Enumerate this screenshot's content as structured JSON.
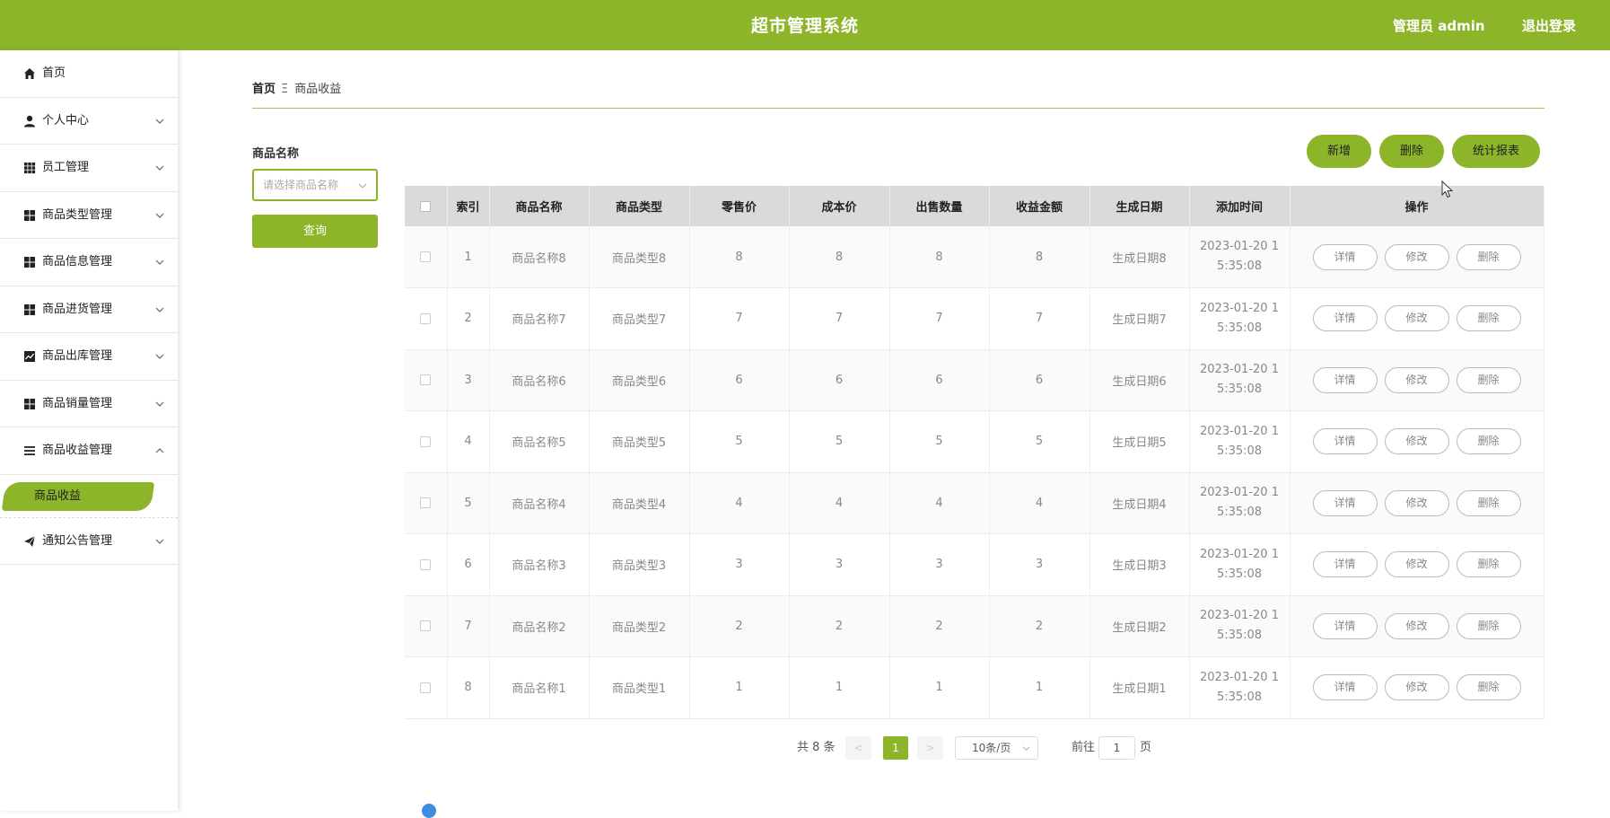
{
  "header": {
    "title": "超市管理系统",
    "user_label": "管理员 admin",
    "logout_label": "退出登录",
    "bg_color": "#8db52a"
  },
  "sidebar": {
    "items": [
      {
        "label": "首页",
        "icon": "home-icon"
      },
      {
        "label": "个人中心",
        "icon": "user-icon"
      },
      {
        "label": "员工管理",
        "icon": "grid-icon"
      },
      {
        "label": "商品类型管理",
        "icon": "apps-icon"
      },
      {
        "label": "商品信息管理",
        "icon": "apps-icon"
      },
      {
        "label": "商品进货管理",
        "icon": "apps-icon"
      },
      {
        "label": "商品出库管理",
        "icon": "chart-icon"
      },
      {
        "label": "商品销量管理",
        "icon": "apps-icon"
      },
      {
        "label": "商品收益管理",
        "icon": "list-icon"
      },
      {
        "label": "通知公告管理",
        "icon": "send-icon"
      }
    ],
    "active_sub": "商品收益"
  },
  "breadcrumb": {
    "home": "首页",
    "separator": "Ξ",
    "current": "商品收益"
  },
  "search": {
    "label": "商品名称",
    "placeholder": "请选择商品名称",
    "query_label": "查询"
  },
  "actions": {
    "add": "新增",
    "delete": "删除",
    "report": "统计报表"
  },
  "table": {
    "headers": [
      "索引",
      "商品名称",
      "商品类型",
      "零售价",
      "成本价",
      "出售数量",
      "收益金额",
      "生成日期",
      "添加时间",
      "操作"
    ],
    "rows": [
      {
        "index": "1",
        "name": "商品名称8",
        "type": "商品类型8",
        "retail": "8",
        "cost": "8",
        "qty": "8",
        "income": "8",
        "date": "生成日期8",
        "time1": "2023-01-20 1",
        "time2": "5:35:08"
      },
      {
        "index": "2",
        "name": "商品名称7",
        "type": "商品类型7",
        "retail": "7",
        "cost": "7",
        "qty": "7",
        "income": "7",
        "date": "生成日期7",
        "time1": "2023-01-20 1",
        "time2": "5:35:08"
      },
      {
        "index": "3",
        "name": "商品名称6",
        "type": "商品类型6",
        "retail": "6",
        "cost": "6",
        "qty": "6",
        "income": "6",
        "date": "生成日期6",
        "time1": "2023-01-20 1",
        "time2": "5:35:08"
      },
      {
        "index": "4",
        "name": "商品名称5",
        "type": "商品类型5",
        "retail": "5",
        "cost": "5",
        "qty": "5",
        "income": "5",
        "date": "生成日期5",
        "time1": "2023-01-20 1",
        "time2": "5:35:08"
      },
      {
        "index": "5",
        "name": "商品名称4",
        "type": "商品类型4",
        "retail": "4",
        "cost": "4",
        "qty": "4",
        "income": "4",
        "date": "生成日期4",
        "time1": "2023-01-20 1",
        "time2": "5:35:08"
      },
      {
        "index": "6",
        "name": "商品名称3",
        "type": "商品类型3",
        "retail": "3",
        "cost": "3",
        "qty": "3",
        "income": "3",
        "date": "生成日期3",
        "time1": "2023-01-20 1",
        "time2": "5:35:08"
      },
      {
        "index": "7",
        "name": "商品名称2",
        "type": "商品类型2",
        "retail": "2",
        "cost": "2",
        "qty": "2",
        "income": "2",
        "date": "生成日期2",
        "time1": "2023-01-20 1",
        "time2": "5:35:08"
      },
      {
        "index": "8",
        "name": "商品名称1",
        "type": "商品类型1",
        "retail": "1",
        "cost": "1",
        "qty": "1",
        "income": "1",
        "date": "生成日期1",
        "time1": "2023-01-20 1",
        "time2": "5:35:08"
      }
    ],
    "ops": {
      "detail": "详情",
      "edit": "修改",
      "delete": "删除"
    }
  },
  "pagination": {
    "total": "共 8 条",
    "prev": "<",
    "page": "1",
    "next": ">",
    "page_size": "10条/页",
    "goto_label": "前往",
    "goto_value": "1",
    "page_unit": "页"
  }
}
